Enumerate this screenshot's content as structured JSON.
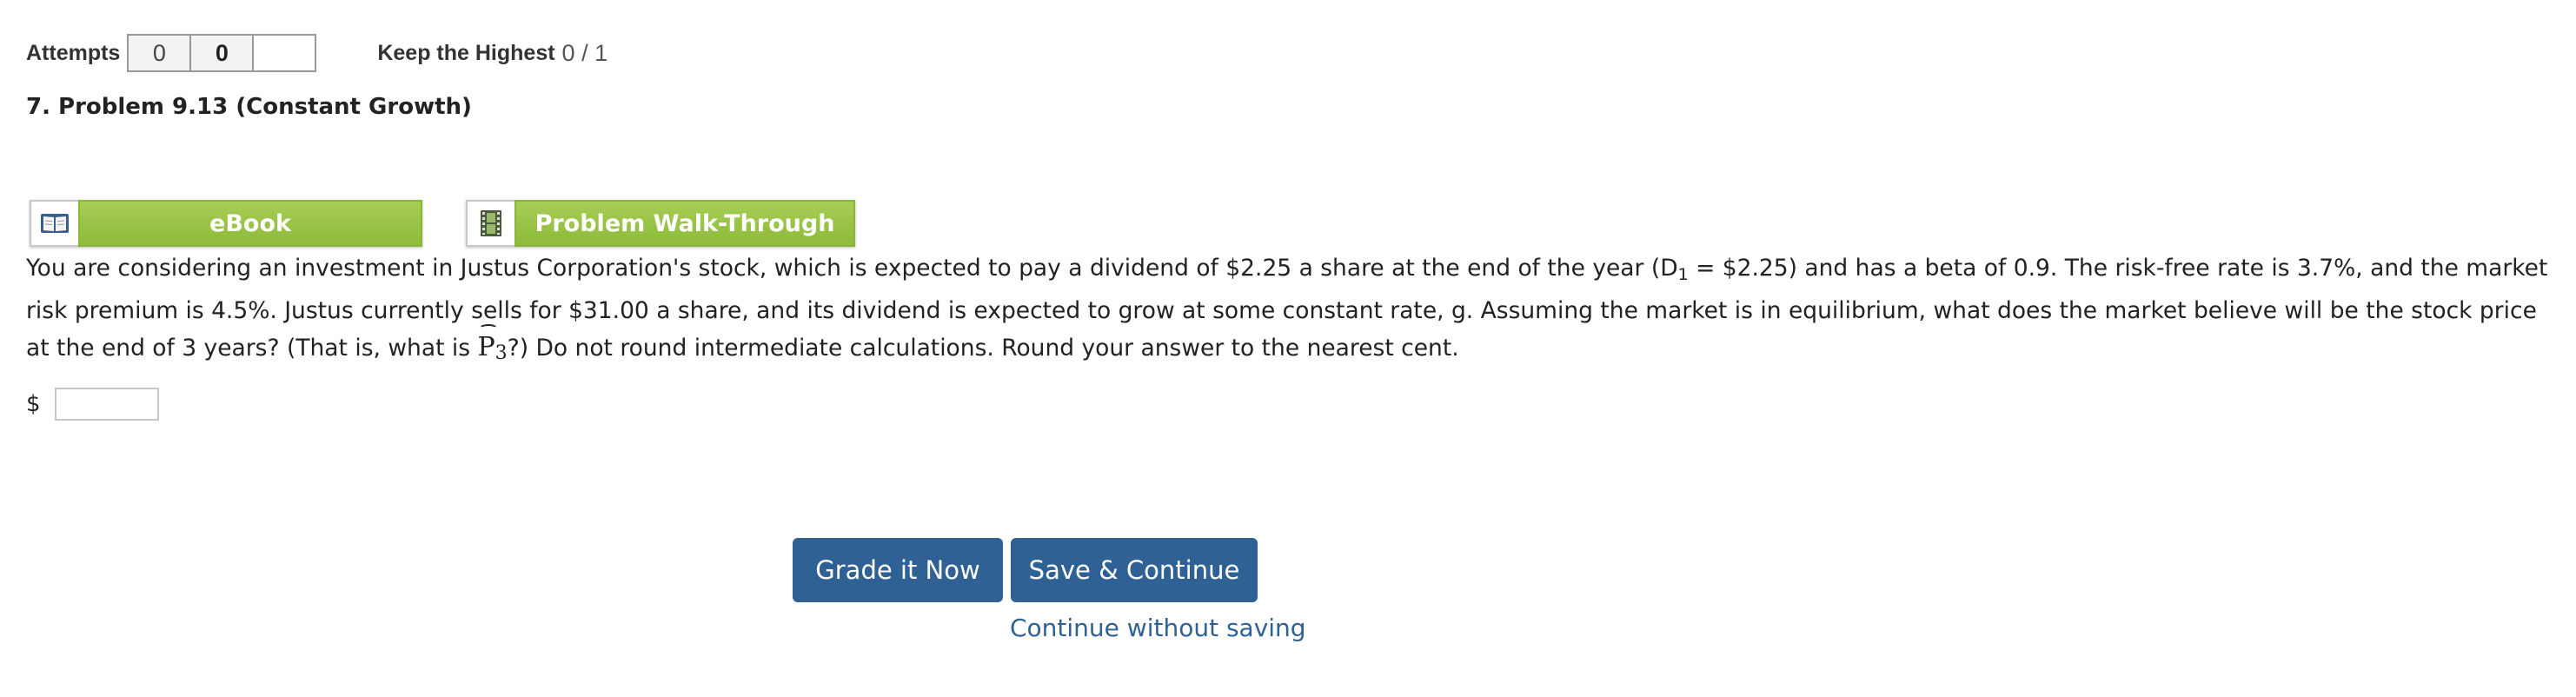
{
  "attempts": {
    "label": "Attempts",
    "boxes": [
      "0",
      "0",
      ""
    ],
    "keep_label": "Keep the Highest",
    "score": "0 / 1"
  },
  "problem": {
    "title": "7.  Problem 9.13 (Constant Growth)"
  },
  "resources": {
    "ebook_label": "eBook",
    "ebook_icon": "book-icon",
    "walkthrough_label": "Problem Walk-Through",
    "walkthrough_icon": "film-icon"
  },
  "question": {
    "part1": "You are considering an investment in Justus Corporation's stock, which is expected to pay a dividend of $2.25 a share at the end of the year (D",
    "sub1": "1",
    "part2": " = $2.25) and has a beta of 0.9. The risk-free rate is 3.7%, and the market risk premium is 4.5%. Justus currently sells for $31.00 a share, and its dividend is expected to grow at some constant rate, g. Assuming the market is in equilibrium, what does the market believe will be the stock price at the end of 3 years? (That is, what is ",
    "p_symbol": "P",
    "p_sub": "3",
    "part3": "?) Do not round intermediate calculations. Round your answer to the nearest cent."
  },
  "answer": {
    "currency": "$",
    "value": "",
    "placeholder": ""
  },
  "actions": {
    "grade_label": "Grade it Now",
    "save_label": "Save & Continue",
    "continue_label": "Continue without saving"
  },
  "colors": {
    "primary_button": "#2f6195",
    "resource_green": "#8dbb3a",
    "link": "#2f6195"
  }
}
